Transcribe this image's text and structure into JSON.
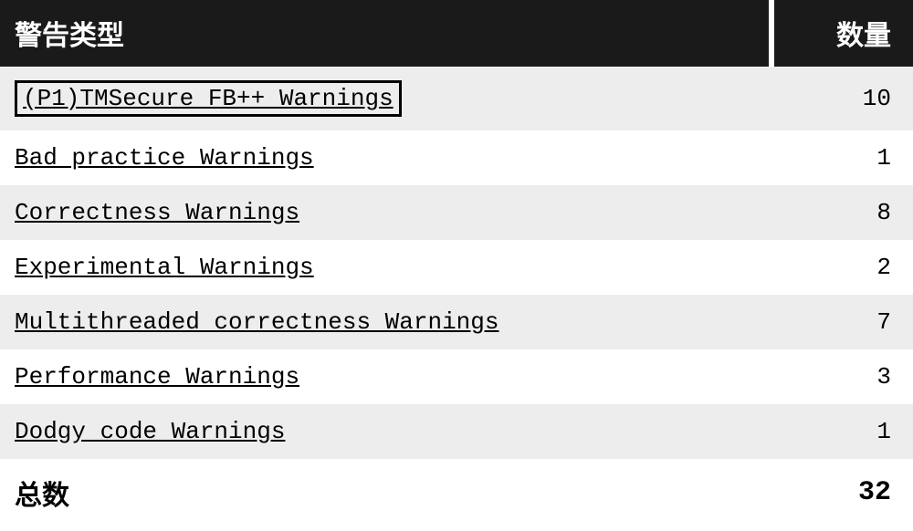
{
  "chart_data": {
    "type": "table",
    "title": "警告类型",
    "columns": [
      "警告类型",
      "数量"
    ],
    "rows": [
      {
        "label": "(P1)TMSecure FB++ Warnings",
        "value": 10
      },
      {
        "label": "Bad practice Warnings",
        "value": 1
      },
      {
        "label": "Correctness Warnings",
        "value": 8
      },
      {
        "label": "Experimental Warnings",
        "value": 2
      },
      {
        "label": "Multithreaded correctness Warnings",
        "value": 7
      },
      {
        "label": "Performance Warnings",
        "value": 3
      },
      {
        "label": "Dodgy code Warnings",
        "value": 1
      }
    ],
    "total_label": "总数",
    "total_value": 32
  },
  "header": {
    "type_label": "警告类型",
    "count_label": "数量"
  },
  "rows": [
    {
      "label": "(P1)TMSecure FB++ Warnings",
      "count": "10",
      "selected": true
    },
    {
      "label": "Bad practice Warnings",
      "count": "1",
      "selected": false
    },
    {
      "label": "Correctness Warnings",
      "count": "8",
      "selected": false
    },
    {
      "label": "Experimental Warnings",
      "count": "2",
      "selected": false
    },
    {
      "label": "Multithreaded correctness Warnings",
      "count": "7",
      "selected": false
    },
    {
      "label": "Performance Warnings",
      "count": "3",
      "selected": false
    },
    {
      "label": "Dodgy code Warnings",
      "count": "1",
      "selected": false
    }
  ],
  "footer": {
    "total_label": "总数",
    "total_value": "32"
  }
}
